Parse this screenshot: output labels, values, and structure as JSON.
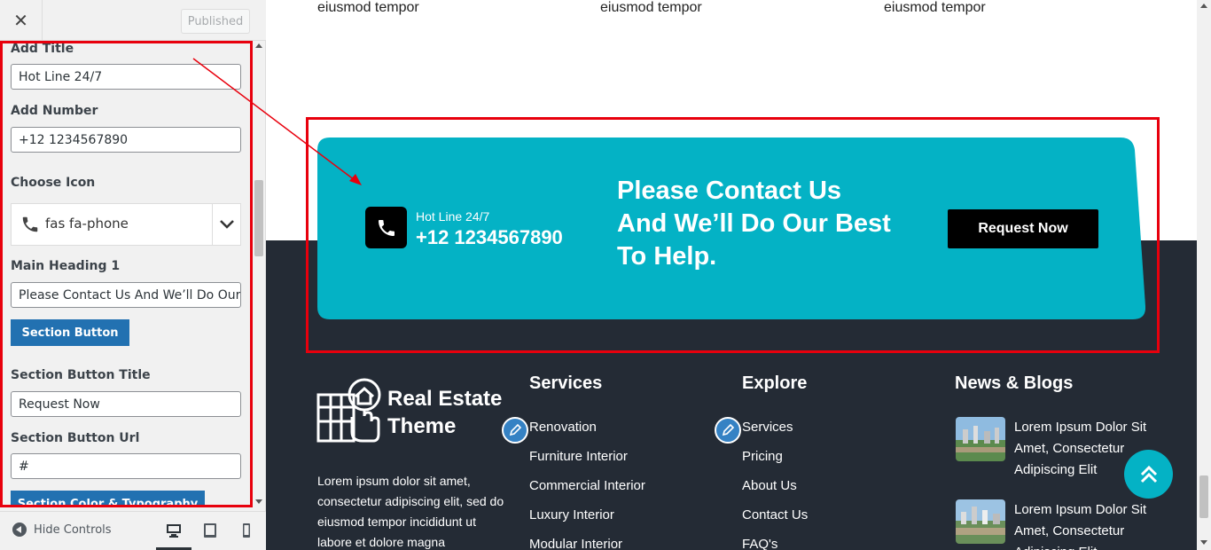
{
  "sidebar": {
    "close_glyph": "✕",
    "published_label": "Published",
    "fields": {
      "add_title_label": "Add Title",
      "add_title_value": "Hot Line 24/7",
      "add_number_label": "Add Number",
      "add_number_value": "+12 1234567890",
      "choose_icon_label": "Choose Icon",
      "choose_icon_value": "fas fa-phone",
      "main_heading_label": "Main Heading 1",
      "main_heading_value": "Please Contact Us And We’ll Do Our Be",
      "section_button_label": "Section Button",
      "section_button_title_label": "Section Button Title",
      "section_button_title_value": "Request Now",
      "section_button_url_label": "Section Button Url",
      "section_button_url_value": "#",
      "section_color_label": "Section Color & Typography"
    },
    "footer": {
      "hide_controls_label": "Hide Controls"
    }
  },
  "preview": {
    "top_texts": [
      "eiusmod tempor",
      "eiusmod tempor",
      "eiusmod tempor"
    ],
    "cta": {
      "hotline_label": "Hot Line 24/7",
      "phone_number": "+12 1234567890",
      "heading_lines": [
        "Please Contact Us",
        "And We’ll Do Our Best",
        "To Help."
      ],
      "button_label": "Request Now"
    },
    "footer": {
      "logo_lines": [
        "Real Estate",
        "Theme"
      ],
      "about_text": "Lorem ipsum dolor sit amet, consectetur adipiscing elit, sed do eiusmod tempor incididunt ut labore et dolore magna",
      "columns": [
        {
          "title": "Services",
          "links": [
            "Renovation",
            "Furniture Interior",
            "Commercial Interior",
            "Luxury Interior",
            "Modular Interior"
          ]
        },
        {
          "title": "Explore",
          "links": [
            "Services",
            "Pricing",
            "About Us",
            "Contact Us",
            "FAQ's"
          ]
        },
        {
          "title": "News & Blogs",
          "posts": [
            "Lorem Ipsum Dolor Sit Amet, Consectetur Adipiscing Elit",
            "Lorem Ipsum Dolor Sit Amet, Consectetur Adipiscing Elit"
          ]
        }
      ]
    }
  },
  "colors": {
    "cta_teal": "#04b2c5",
    "footer_dark": "#242b35",
    "wp_blue": "#2271b1",
    "highlight_red": "#e8000d"
  },
  "icons": [
    "close-icon",
    "phone-icon",
    "chevron-down-icon",
    "arrow-left-circle-icon",
    "desktop-icon",
    "tablet-icon",
    "mobile-icon",
    "pencil-icon",
    "double-chevron-up-icon",
    "house-logo-icon"
  ]
}
